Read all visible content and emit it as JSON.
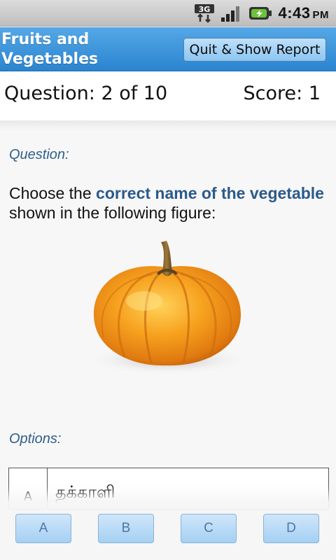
{
  "status_bar": {
    "network": "3G",
    "time": "4:43",
    "ampm": "PM",
    "icons": [
      "3g-data-icon",
      "signal-icon",
      "battery-charging-icon"
    ]
  },
  "header": {
    "title": "Fruits and Vegetables",
    "quit_button": "Quit & Show Report"
  },
  "quiz": {
    "question_progress": "Question: 2 of 10",
    "score": "Score: 1"
  },
  "question": {
    "label": "Question:",
    "text_before": "Choose the ",
    "text_highlight": "correct name of the vegetable",
    "text_after": " shown in the following figure:",
    "image": "pumpkin-image"
  },
  "options": {
    "label": "Options:",
    "items": [
      {
        "letter": "A",
        "text": "தக்காளி"
      }
    ]
  },
  "answer_buttons": [
    "A",
    "B",
    "C",
    "D"
  ],
  "colors": {
    "title_bar": "#2a84d0",
    "accent_text": "#2b5a8a",
    "button_fill": "#a5d0f3"
  }
}
